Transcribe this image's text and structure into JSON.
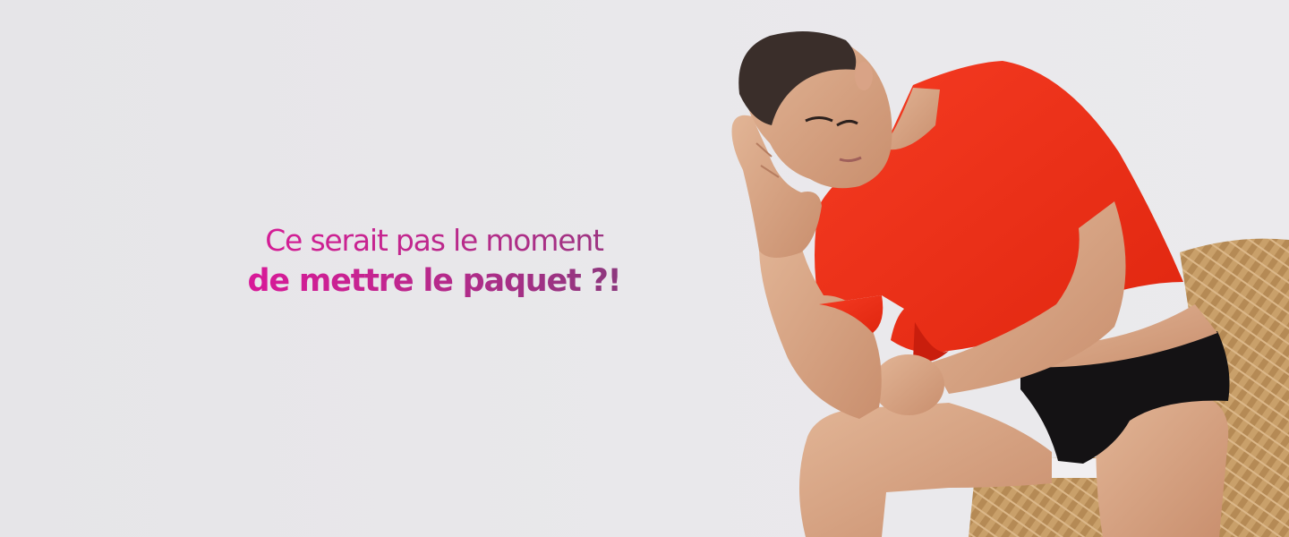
{
  "headline": {
    "line1": "Ce serait pas le moment",
    "line2": "de mettre le paquet ?!"
  },
  "colors": {
    "background": "#e9e8eb",
    "accent_pink": "#e0179a",
    "accent_plum": "#8d3a7c",
    "shirt_red": "#f02a16",
    "briefs_black": "#141214",
    "chair_wicker": "#c39a62"
  },
  "photo": {
    "subject": "man-in-red-tshirt-icon"
  }
}
